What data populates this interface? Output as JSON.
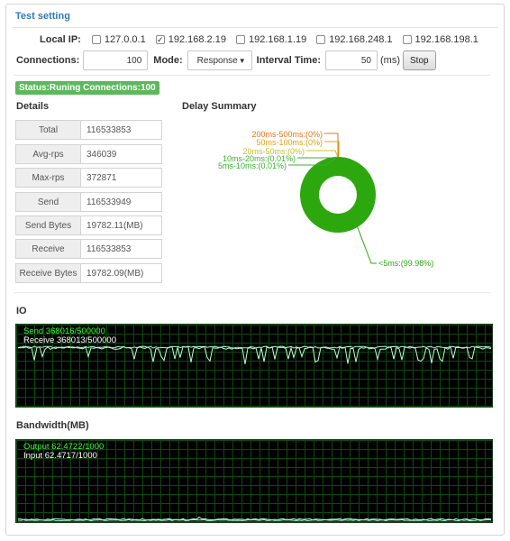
{
  "panel": {
    "title": "Test setting"
  },
  "settings": {
    "local_ip_label": "Local IP:",
    "ip_options": [
      {
        "label": "127.0.0.1",
        "checked": false
      },
      {
        "label": "192.168.2.19",
        "checked": true
      },
      {
        "label": "192.168.1.19",
        "checked": false
      },
      {
        "label": "192.168.248.1",
        "checked": false
      },
      {
        "label": "192.168.198.1",
        "checked": false
      }
    ],
    "connections_label": "Connections:",
    "connections_value": "100",
    "mode_label": "Mode:",
    "mode_value": "Response",
    "interval_label": "Interval Time:",
    "interval_value": "50",
    "interval_unit": "(ms)",
    "stop_label": "Stop"
  },
  "status": {
    "text": "Status:Runing Connections:100",
    "color": "#5cb85c"
  },
  "details": {
    "title": "Details",
    "rows": [
      {
        "label": "Total",
        "value": "116533853"
      },
      {
        "label": "Avg-rps",
        "value": "346039"
      },
      {
        "label": "Max-rps",
        "value": "372871"
      },
      {
        "label": "Send",
        "value": "116533949"
      },
      {
        "label": "Send Bytes",
        "value": "19782.11(MB)"
      },
      {
        "label": "Receive",
        "value": "116533853"
      },
      {
        "label": "Receive Bytes",
        "value": "19782.09(MB)"
      }
    ]
  },
  "chart_data": {
    "type": "pie",
    "title": "Delay Summary",
    "donut": true,
    "slices": [
      {
        "label": "200ms-500ms:(0%)",
        "value": 0,
        "color": "#e8741a"
      },
      {
        "label": "50ms-100ms:(0%)",
        "value": 0,
        "color": "#e0a010"
      },
      {
        "label": "20ms-50ms:(0%)",
        "value": 0,
        "color": "#c8c020"
      },
      {
        "label": "10ms-20ms:(0.01%)",
        "value": 0.01,
        "color": "#38b030"
      },
      {
        "label": "5ms-10ms:(0.01%)",
        "value": 0.01,
        "color": "#38b030"
      },
      {
        "label": "<5ms:(99.98%)",
        "value": 99.98,
        "color": "#2ca80e"
      }
    ]
  },
  "io": {
    "title": "IO",
    "send_text": "Send 368016/500000",
    "receive_text": "Receive 368013/500000",
    "send_color": "#33ff33",
    "receive_color": "#ffffff"
  },
  "bandwidth": {
    "title": "Bandwidth(MB)",
    "output_text": "Output 62.4722/1000",
    "input_text": "Input 62.4717/1000",
    "output_color": "#33ff33",
    "input_color": "#ffffff"
  }
}
